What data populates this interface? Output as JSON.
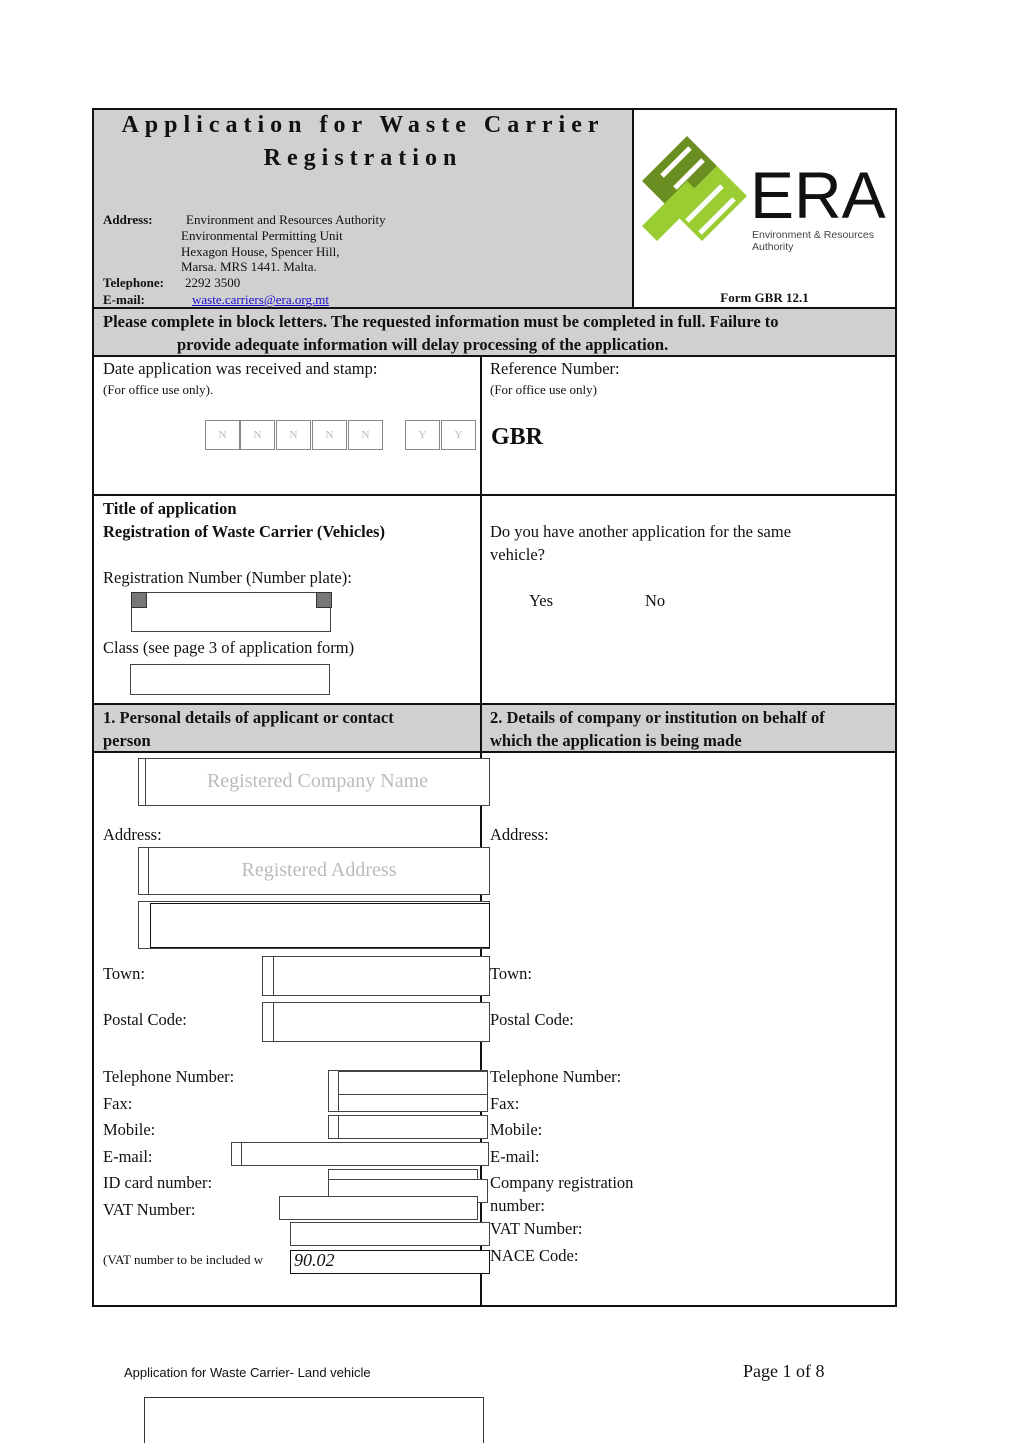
{
  "header": {
    "title_line1": "Application for Waste Carrier",
    "title_line2": "Registration",
    "address_label": "Address:",
    "address_lines": [
      "Environment and Resources Authority",
      "Environmental Permitting Unit",
      "Hexagon House, Spencer Hill,",
      "Marsa. MRS 1441. Malta."
    ],
    "telephone_label": "Telephone:",
    "telephone": "2292 3500",
    "email_label": "E-mail:",
    "email": "waste.carriers@era.org.mt",
    "logo_text": "ERA",
    "logo_sub1": "Environment & Resources",
    "logo_sub2": "Authority",
    "form_code": "Form GBR 12.1",
    "colors": {
      "logo_dark": "#6b8e23",
      "logo_light": "#9acd32",
      "header_bg": "#d0d0d0"
    }
  },
  "instructions": {
    "line1": "Please complete in block letters. The requested information must be completed in full. Failure to",
    "line2": "provide adequate information will delay processing of the application."
  },
  "office": {
    "date_label": "Date application was received and stamp:",
    "date_note": "(For office use only).",
    "date_cells": [
      "N",
      "N",
      "N",
      "N",
      "N",
      "Y",
      "Y"
    ],
    "ref_label": "Reference Number:",
    "ref_note": "(For office use only)",
    "ref_prefix": "GBR"
  },
  "title_section": {
    "title_label": "Title of application",
    "title_value": "Registration of Waste Carrier (Vehicles)",
    "reg_label": "Registration Number (Number plate):",
    "class_label": "Class (see page 3 of application form)",
    "question": "Do you have another application for the same",
    "question2": "vehicle?",
    "yes": "Yes",
    "no": "No"
  },
  "section1": {
    "heading1": "1. Personal details of applicant or contact",
    "heading2": "person",
    "company_placeholder": "Registered Company Name",
    "address_label": "Address:",
    "address_placeholder": "Registered Address",
    "town": "Town:",
    "postal": "Postal Code:",
    "telephone": "Telephone Number:",
    "fax": "Fax:",
    "mobile": "Mobile:",
    "email": "E-mail:",
    "id_card": "ID card number:",
    "vat": "VAT Number:",
    "vat_note": "(VAT number to be included w",
    "nace_value": "90.02"
  },
  "section2": {
    "heading1": "2. Details of company or institution on behalf of",
    "heading2": "which the application is being made",
    "address_label": "Address:",
    "town": "Town:",
    "postal": "Postal Code:",
    "telephone": "Telephone Number:",
    "fax": "Fax:",
    "mobile": "Mobile:",
    "email": "E-mail:",
    "company_reg1": "Company registration",
    "company_reg2": "number:",
    "vat": "VAT Number:",
    "nace": "NACE Code:"
  },
  "footer": {
    "doc_title": "Application for Waste Carrier- Land vehicle",
    "page": "Page 1 of 8"
  }
}
